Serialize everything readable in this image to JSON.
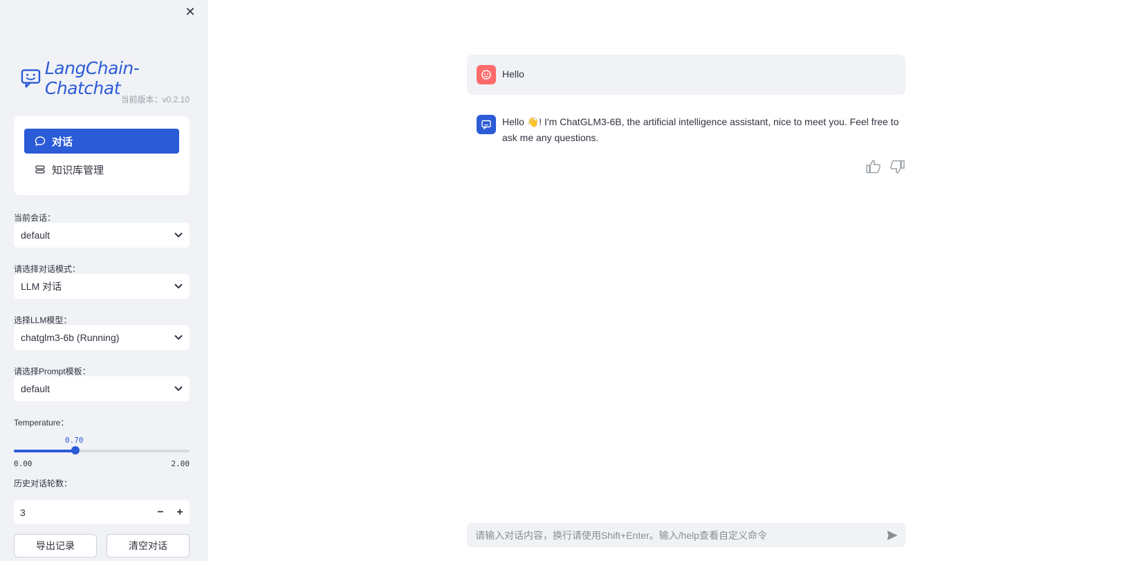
{
  "sidebar": {
    "close_glyph": "✕",
    "logo_text": "LangChain-Chatchat",
    "version": "当前版本：v0.2.10",
    "nav": [
      {
        "label": "对话",
        "icon": "chat-bubble-icon",
        "active": true
      },
      {
        "label": "知识库管理",
        "icon": "database-icon",
        "active": false
      }
    ],
    "current_session": {
      "label": "当前会话：",
      "value": "default"
    },
    "dialog_mode": {
      "label": "请选择对话模式：",
      "value": "LLM 对话"
    },
    "llm_model": {
      "label": "选择LLM模型：",
      "value": "chatglm3-6b (Running)"
    },
    "prompt_template": {
      "label": "请选择Prompt模板：",
      "value": "default"
    },
    "temperature": {
      "label": "Temperature：",
      "value": "0.70",
      "min": "0.00",
      "max": "2.00",
      "fraction": 0.35
    },
    "history_rounds": {
      "label": "历史对话轮数：",
      "value": "3",
      "minus": "−",
      "plus": "+"
    },
    "export_button": "导出记录",
    "clear_button": "清空对话"
  },
  "chat": {
    "messages": [
      {
        "role": "user",
        "text": "Hello"
      },
      {
        "role": "assistant",
        "text": "Hello 👋! I'm ChatGLM3-6B, the artificial intelligence assistant, nice to meet you. Feel free to ask me any questions."
      }
    ],
    "input_placeholder": "请输入对话内容，换行请使用Shift+Enter。输入/help查看自定义命令"
  },
  "colors": {
    "accent": "#2b5bd7",
    "user_avatar": "#ff6b6b",
    "sidebar_bg": "#f0f2f6"
  }
}
